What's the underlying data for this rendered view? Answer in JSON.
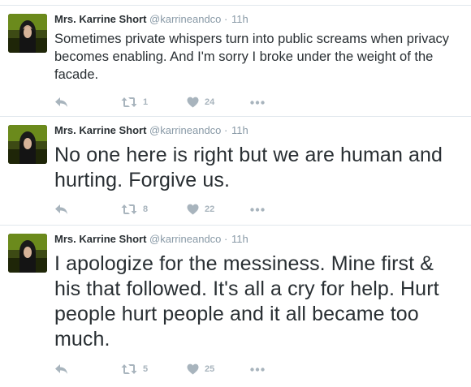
{
  "tweets": [
    {
      "name": "Mrs. Karrine Short",
      "handle": "@karrineandco",
      "separator": "·",
      "time": "11h",
      "text": "Sometimes private whispers turn into public screams when privacy becomes enabling. And I'm sorry I broke under the weight of the facade.",
      "retweets": "1",
      "likes": "24"
    },
    {
      "name": "Mrs. Karrine Short",
      "handle": "@karrineandco",
      "separator": "·",
      "time": "11h",
      "text": "No one here is right but we are human and hurting. Forgive us.",
      "retweets": "8",
      "likes": "22"
    },
    {
      "name": "Mrs. Karrine Short",
      "handle": "@karrineandco",
      "separator": "·",
      "time": "11h",
      "text": "I apologize for the messiness. Mine first & his that followed. It's all a cry for help. Hurt people hurt people and it all became too much.",
      "retweets": "5",
      "likes": "25"
    }
  ],
  "icons": {
    "reply": "reply-icon",
    "retweet": "retweet-icon",
    "like": "heart-icon",
    "more": "more-icon"
  },
  "colors": {
    "text": "#292f33",
    "meta": "#8899a6",
    "action": "#a8b4bd",
    "divider": "#e1e8ed"
  }
}
